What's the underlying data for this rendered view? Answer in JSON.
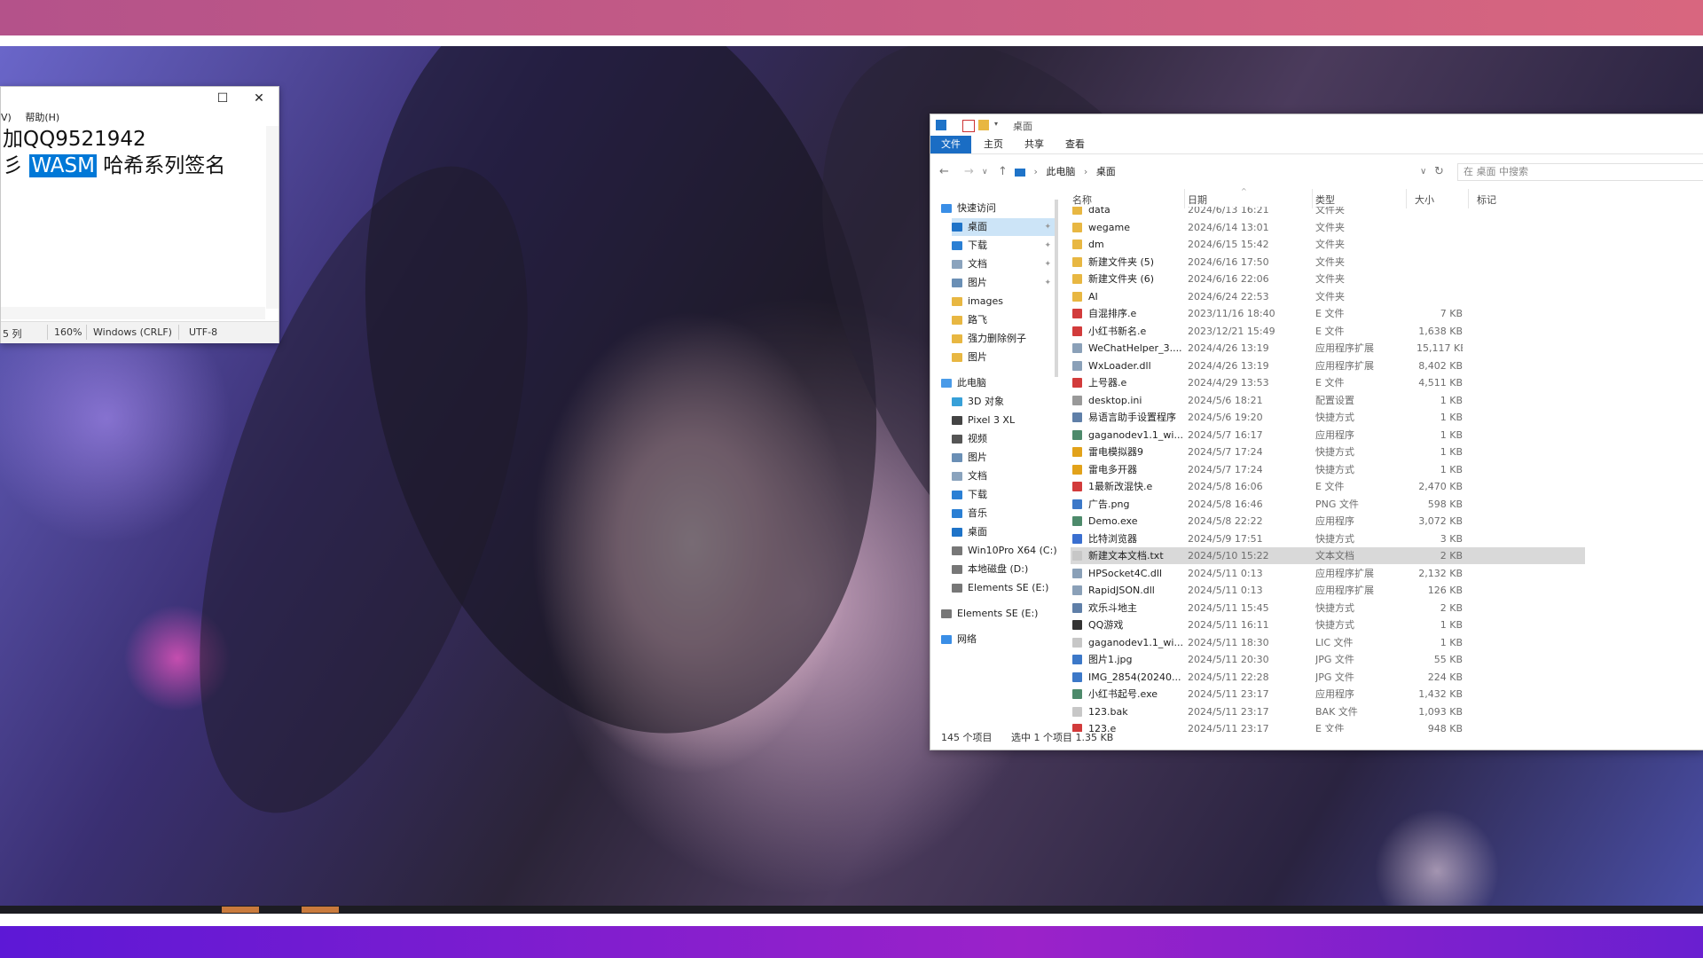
{
  "notepad": {
    "menu": [
      "V)",
      "帮助(H)"
    ],
    "controls": {
      "maximize": "☐",
      "close": "✕"
    },
    "lines": [
      {
        "pre": "加QQ9521942",
        "sel": "",
        "post": ""
      },
      {
        "pre": "彡 ",
        "sel": "WASM",
        "post": " 哈希系列签名"
      }
    ],
    "status": {
      "pos": "5 列",
      "zoom": "160%",
      "eol": "Windows (CRLF)",
      "enc": "UTF-8"
    }
  },
  "explorer": {
    "title": "桌面",
    "ribbon_tabs": [
      "文件",
      "主页",
      "共享",
      "查看"
    ],
    "breadcrumb": [
      "此电脑",
      "桌面"
    ],
    "search_placeholder": "在 桌面 中搜索",
    "headers": {
      "name": "名称",
      "date": "日期",
      "type": "类型",
      "size": "大小",
      "tags": "标记"
    },
    "nav": [
      {
        "label": "快速访问",
        "indent": 0,
        "icon": "star-icon",
        "pin": false
      },
      {
        "label": "桌面",
        "indent": 1,
        "icon": "desktop-icon",
        "pin": true,
        "selected": true
      },
      {
        "label": "下载",
        "indent": 1,
        "icon": "download-icon",
        "pin": true
      },
      {
        "label": "文档",
        "indent": 1,
        "icon": "document-icon",
        "pin": true
      },
      {
        "label": "图片",
        "indent": 1,
        "icon": "picture-icon",
        "pin": true
      },
      {
        "label": "images",
        "indent": 1,
        "icon": "folder-icon",
        "pin": false
      },
      {
        "label": "路飞",
        "indent": 1,
        "icon": "folder-icon",
        "pin": false
      },
      {
        "label": "强力删除例子",
        "indent": 1,
        "icon": "folder-icon",
        "pin": false
      },
      {
        "label": "图片",
        "indent": 1,
        "icon": "folder-icon",
        "pin": false
      },
      {
        "label": "此电脑",
        "indent": 0,
        "icon": "computer-icon",
        "pin": false
      },
      {
        "label": "3D 对象",
        "indent": 1,
        "icon": "cube-icon",
        "pin": false
      },
      {
        "label": "Pixel 3 XL",
        "indent": 1,
        "icon": "phone-icon",
        "pin": false
      },
      {
        "label": "视频",
        "indent": 1,
        "icon": "video-icon",
        "pin": false
      },
      {
        "label": "图片",
        "indent": 1,
        "icon": "picture-icon",
        "pin": false
      },
      {
        "label": "文档",
        "indent": 1,
        "icon": "document-icon",
        "pin": false
      },
      {
        "label": "下载",
        "indent": 1,
        "icon": "download-icon",
        "pin": false
      },
      {
        "label": "音乐",
        "indent": 1,
        "icon": "music-icon",
        "pin": false
      },
      {
        "label": "桌面",
        "indent": 1,
        "icon": "desktop-icon",
        "pin": false
      },
      {
        "label": "Win10Pro X64 (C:)",
        "indent": 1,
        "icon": "drive-icon",
        "pin": false
      },
      {
        "label": "本地磁盘 (D:)",
        "indent": 1,
        "icon": "drive-icon",
        "pin": false
      },
      {
        "label": "Elements SE (E:)",
        "indent": 1,
        "icon": "drive-icon",
        "pin": false
      },
      {
        "label": "Elements SE (E:)",
        "indent": 0,
        "icon": "drive-icon",
        "pin": false
      },
      {
        "label": "网络",
        "indent": 0,
        "icon": "network-icon",
        "pin": false
      }
    ],
    "files": [
      {
        "name": "data",
        "date": "2024/6/13 16:21",
        "type": "文件夹",
        "size": "",
        "icon": "folder"
      },
      {
        "name": "wegame",
        "date": "2024/6/14 13:01",
        "type": "文件夹",
        "size": "",
        "icon": "folder"
      },
      {
        "name": "dm",
        "date": "2024/6/15 15:42",
        "type": "文件夹",
        "size": "",
        "icon": "folder"
      },
      {
        "name": "新建文件夹 (5)",
        "date": "2024/6/16 17:50",
        "type": "文件夹",
        "size": "",
        "icon": "folder"
      },
      {
        "name": "新建文件夹 (6)",
        "date": "2024/6/16 22:06",
        "type": "文件夹",
        "size": "",
        "icon": "folder"
      },
      {
        "name": "AI",
        "date": "2024/6/24 22:53",
        "type": "文件夹",
        "size": "",
        "icon": "folder"
      },
      {
        "name": "自混排序.e",
        "date": "2023/11/16 18:40",
        "type": "E 文件",
        "size": "7 KB",
        "icon": "e"
      },
      {
        "name": "小红书新名.e",
        "date": "2023/12/21 15:49",
        "type": "E 文件",
        "size": "1,638 KB",
        "icon": "e"
      },
      {
        "name": "WeChatHelper_3....",
        "date": "2024/4/26 13:19",
        "type": "应用程序扩展",
        "size": "15,117 KB",
        "icon": "dll"
      },
      {
        "name": "WxLoader.dll",
        "date": "2024/4/26 13:19",
        "type": "应用程序扩展",
        "size": "8,402 KB",
        "icon": "dll"
      },
      {
        "name": "上号器.e",
        "date": "2024/4/29 13:53",
        "type": "E 文件",
        "size": "4,511 KB",
        "icon": "e"
      },
      {
        "name": "desktop.ini",
        "date": "2024/5/6 18:21",
        "type": "配置设置",
        "size": "1 KB",
        "icon": "ini"
      },
      {
        "name": "易语言助手设置程序",
        "date": "2024/5/6 19:20",
        "type": "快捷方式",
        "size": "1 KB",
        "icon": "lnk"
      },
      {
        "name": "gaganodev1.1_wi...",
        "date": "2024/5/7 16:17",
        "type": "应用程序",
        "size": "1 KB",
        "icon": "exe"
      },
      {
        "name": "雷电模拟器9",
        "date": "2024/5/7 17:24",
        "type": "快捷方式",
        "size": "1 KB",
        "icon": "ld"
      },
      {
        "name": "雷电多开器",
        "date": "2024/5/7 17:24",
        "type": "快捷方式",
        "size": "1 KB",
        "icon": "ld"
      },
      {
        "name": "1最新改混快.e",
        "date": "2024/5/8 16:06",
        "type": "E 文件",
        "size": "2,470 KB",
        "icon": "e"
      },
      {
        "name": "广告.png",
        "date": "2024/5/8 16:46",
        "type": "PNG 文件",
        "size": "598 KB",
        "icon": "img"
      },
      {
        "name": "Demo.exe",
        "date": "2024/5/8 22:22",
        "type": "应用程序",
        "size": "3,072 KB",
        "icon": "exe"
      },
      {
        "name": "比特浏览器",
        "date": "2024/5/9 17:51",
        "type": "快捷方式",
        "size": "3 KB",
        "icon": "bit"
      },
      {
        "name": "新建文本文档.txt",
        "date": "2024/5/10 15:22",
        "type": "文本文档",
        "size": "2 KB",
        "icon": "txt",
        "selected": true
      },
      {
        "name": "HPSocket4C.dll",
        "date": "2024/5/11 0:13",
        "type": "应用程序扩展",
        "size": "2,132 KB",
        "icon": "dll"
      },
      {
        "name": "RapidJSON.dll",
        "date": "2024/5/11 0:13",
        "type": "应用程序扩展",
        "size": "126 KB",
        "icon": "dll"
      },
      {
        "name": "欢乐斗地主",
        "date": "2024/5/11 15:45",
        "type": "快捷方式",
        "size": "2 KB",
        "icon": "lnk"
      },
      {
        "name": "QQ游戏",
        "date": "2024/5/11 16:11",
        "type": "快捷方式",
        "size": "1 KB",
        "icon": "qq"
      },
      {
        "name": "gaganodev1.1_wi...",
        "date": "2024/5/11 18:30",
        "type": "LIC 文件",
        "size": "1 KB",
        "icon": "txt"
      },
      {
        "name": "图片1.jpg",
        "date": "2024/5/11 20:30",
        "type": "JPG 文件",
        "size": "55 KB",
        "icon": "img"
      },
      {
        "name": "IMG_2854(20240...",
        "date": "2024/5/11 22:28",
        "type": "JPG 文件",
        "size": "224 KB",
        "icon": "img"
      },
      {
        "name": "小红书起号.exe",
        "date": "2024/5/11 23:17",
        "type": "应用程序",
        "size": "1,432 KB",
        "icon": "exe"
      },
      {
        "name": "123.bak",
        "date": "2024/5/11 23:17",
        "type": "BAK 文件",
        "size": "1,093 KB",
        "icon": "txt"
      },
      {
        "name": "123.e",
        "date": "2024/5/11 23:17",
        "type": "E 文件",
        "size": "948 KB",
        "icon": "e"
      }
    ],
    "status": {
      "count": "145 个项目",
      "selection": "选中 1 个项目  1.35 KB"
    }
  },
  "colors": {
    "accent": "#1a6dc4",
    "folder": "#e8b742",
    "e_file": "#d23b3b",
    "selection": "#0078d7"
  }
}
